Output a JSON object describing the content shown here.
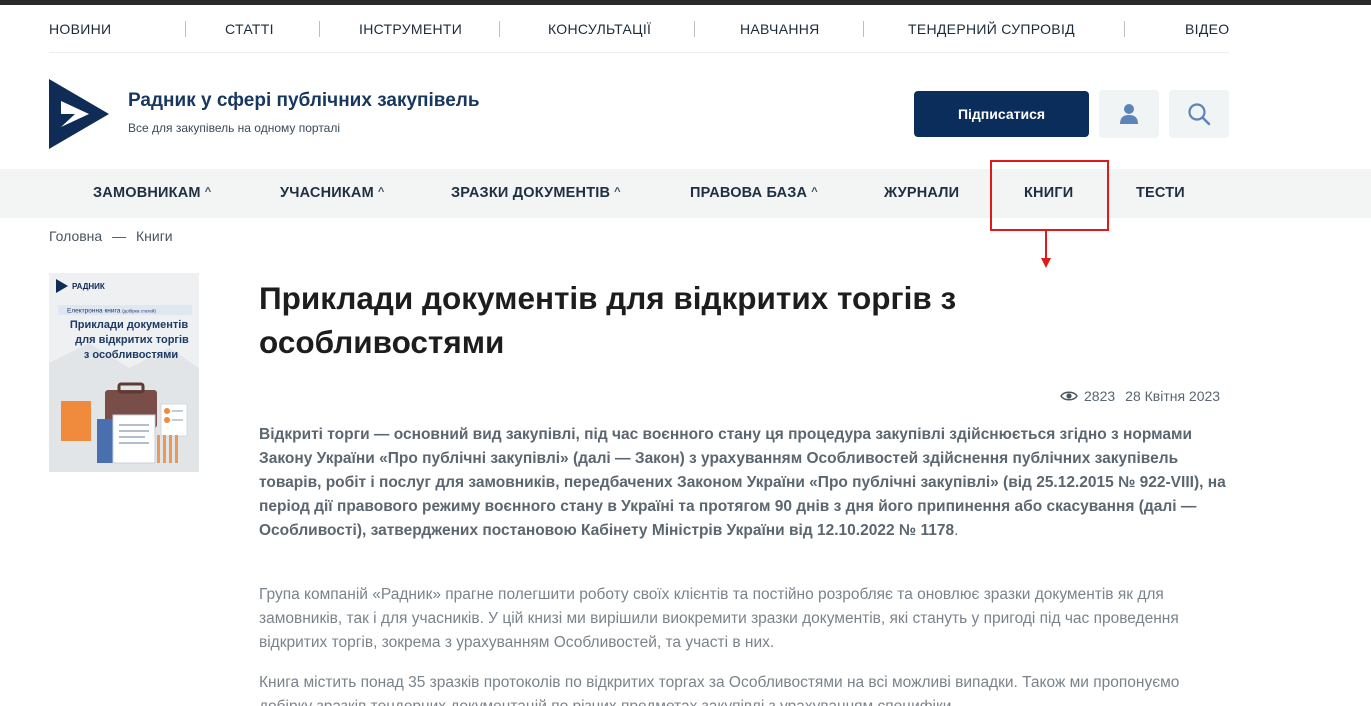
{
  "top_nav": {
    "items": [
      "НОВИНИ",
      "СТАТТІ",
      "ІНСТРУМЕНТИ",
      "КОНСУЛЬТАЦІЇ",
      "НАВЧАННЯ",
      "ТЕНДЕРНИЙ СУПРОВІД",
      "ВІДЕО"
    ]
  },
  "brand": {
    "title": "Радник у сфері публічних закупівель",
    "subtitle": "Все для закупівель на одному порталі"
  },
  "header": {
    "subscribe_label": "Підписатися",
    "user_icon": "user-icon",
    "search_icon": "search-icon"
  },
  "main_nav": {
    "items": [
      "ЗАМОВНИКАМ",
      "УЧАСНИКАМ",
      "ЗРАЗКИ ДОКУМЕНТІВ",
      "ПРАВОВА БАЗА",
      "ЖУРНАЛИ",
      "КНИГИ",
      "ТЕСТИ"
    ],
    "highlighted": "КНИГИ"
  },
  "breadcrumb": {
    "home": "Головна",
    "separator": "—",
    "current": "Книги"
  },
  "cover": {
    "brand": "РАДНИК",
    "label": "Електронна книга",
    "label_note": "(добірка статей)",
    "title_lines": [
      "Приклади документів",
      "для відкритих торгів",
      "з особливостями"
    ]
  },
  "article": {
    "title": "Приклади документів для відкритих торгів з особливостями",
    "views": "2823",
    "date": "28 Квітня 2023",
    "lead": "Відкриті торги — основний вид закупівлі, під час воєнного стану ця процедура закупівлі здійснюється  згідно з нормами Закону України «Про публічні закупівлі» (далі — Закон) з урахуванням Особливостей здійснення публічних закупівель товарів, робіт і послуг для замовників, передбачених Законом України «Про публічні закупівлі» (від 25.12.2015 № 922-VIII), на період дії правового режиму воєнного стану в Україні та протягом 90 днів з дня його припинення або скасування (далі — Особливості), затверджених постановою Кабінету Міністрів України від 12.10.2022 № 1178",
    "lead_end": ".",
    "paragraph1": "Група компаній «Радник» прагне полегшити роботу своїх клієнтів та постійно розробляє та оновлює зразки документів як для замовників, так і для учасників. У цій книзі ми вирішили виокремити зразки документів, які стануть у пригоді під час проведення відкритих торгів, зокрема  з урахуванням Особливостей, та участі в них.",
    "paragraph2": "Книга містить понад 35 зразків протоколів по відкритих торгах за Особливостями на всі можливі випадки. Також ми пропонуємо добірку зразків тендерних документацій по різних предметах закупівлі з урахуванням специфіки"
  },
  "colors": {
    "brand_navy": "#0b2d5b",
    "highlight_red": "#e01919",
    "nav_bg": "#f3f5f5"
  }
}
